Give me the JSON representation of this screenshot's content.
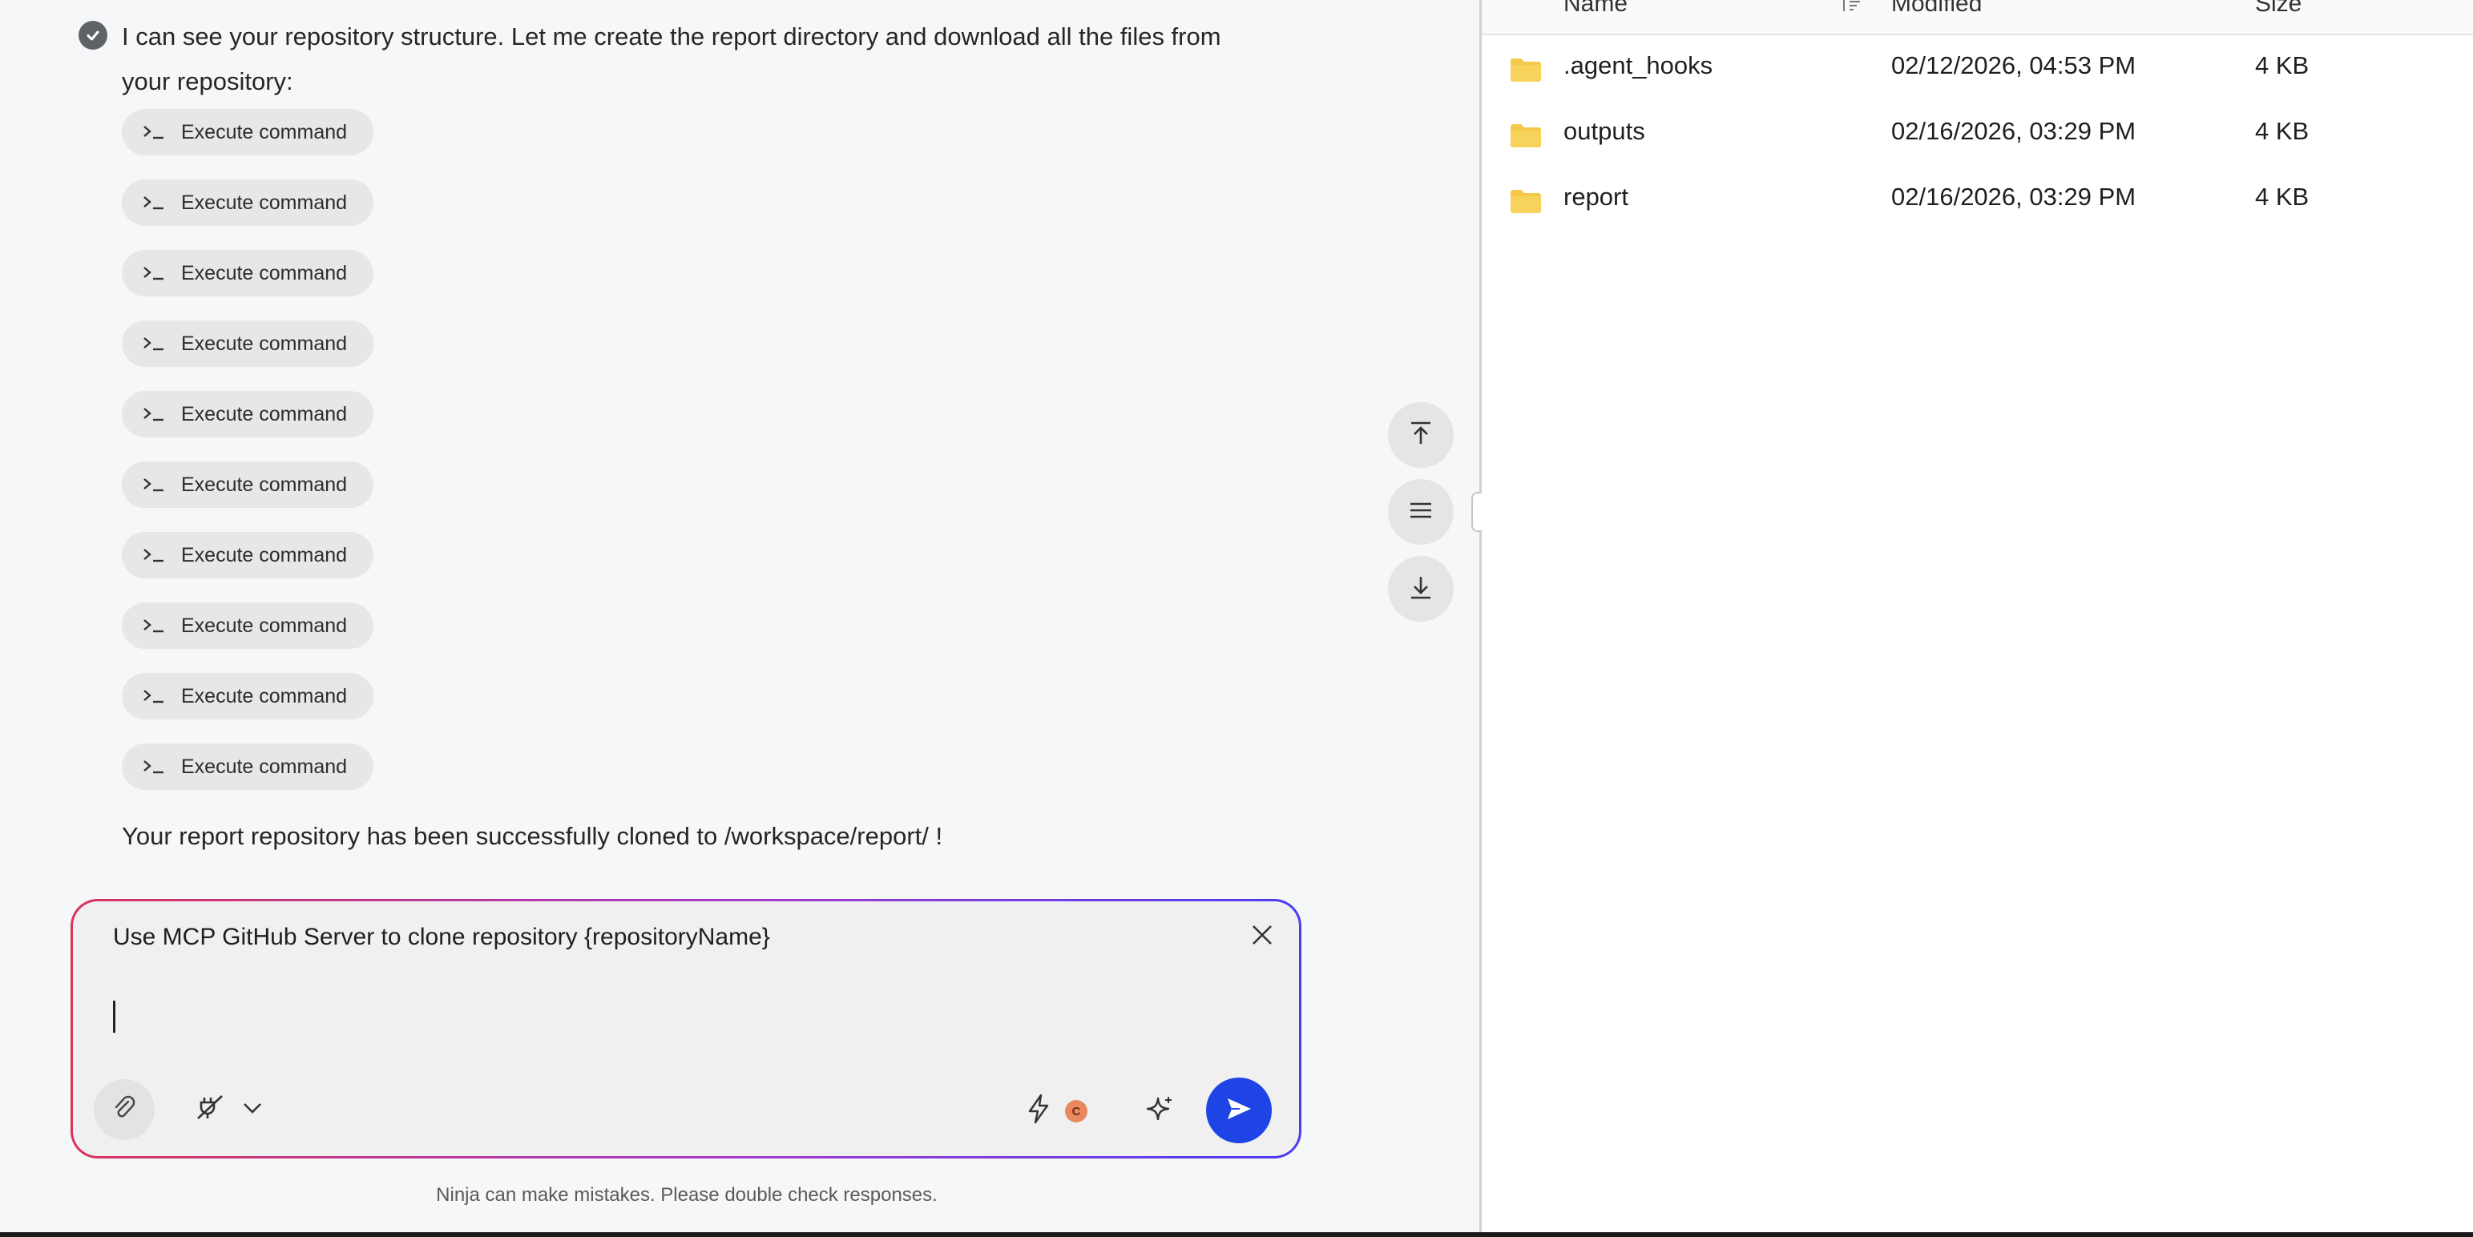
{
  "chat": {
    "message": "I can see your repository structure. Let me create the report directory and download all the files from your repository:",
    "commands": [
      {
        "label": "Execute command"
      },
      {
        "label": "Execute command"
      },
      {
        "label": "Execute command"
      },
      {
        "label": "Execute command"
      },
      {
        "label": "Execute command"
      },
      {
        "label": "Execute command"
      },
      {
        "label": "Execute command"
      },
      {
        "label": "Execute command"
      },
      {
        "label": "Execute command"
      },
      {
        "label": "Execute command"
      }
    ],
    "result": "Your report repository has been successfully cloned to  /workspace/report/ !"
  },
  "composer": {
    "prompt_template": "Use MCP GitHub Server to clone repository {repositoryName}",
    "input_value": "",
    "model_badge": "C"
  },
  "footer": {
    "disclaimer": "Ninja can make mistakes. Please double check responses."
  },
  "file_browser": {
    "columns": {
      "name": "Name",
      "modified": "Modified",
      "size": "Size"
    },
    "rows": [
      {
        "name": ".agent_hooks",
        "modified": "02/12/2026, 04:53 PM",
        "size": "4 KB"
      },
      {
        "name": "outputs",
        "modified": "02/16/2026, 03:29 PM",
        "size": "4 KB"
      },
      {
        "name": "report",
        "modified": "02/16/2026, 03:29 PM",
        "size": "4 KB"
      }
    ]
  },
  "icons": {
    "status": "check-circle-icon",
    "command": "terminal-icon",
    "scroll_top": "arrow-to-top-icon",
    "outline": "menu-lines-icon",
    "scroll_bottom": "arrow-to-bottom-icon",
    "close": "close-icon",
    "attach": "paperclip-icon",
    "tools": "plug-off-icon",
    "bolt": "lightning-icon",
    "sparkle": "sparkle-icon",
    "send": "send-icon",
    "folder": "folder-icon"
  },
  "colors": {
    "accent_send": "#1f44e6",
    "folder": "#f5c84a",
    "composer_border_start": "#d9345b",
    "composer_border_end": "#4a3cf0"
  }
}
